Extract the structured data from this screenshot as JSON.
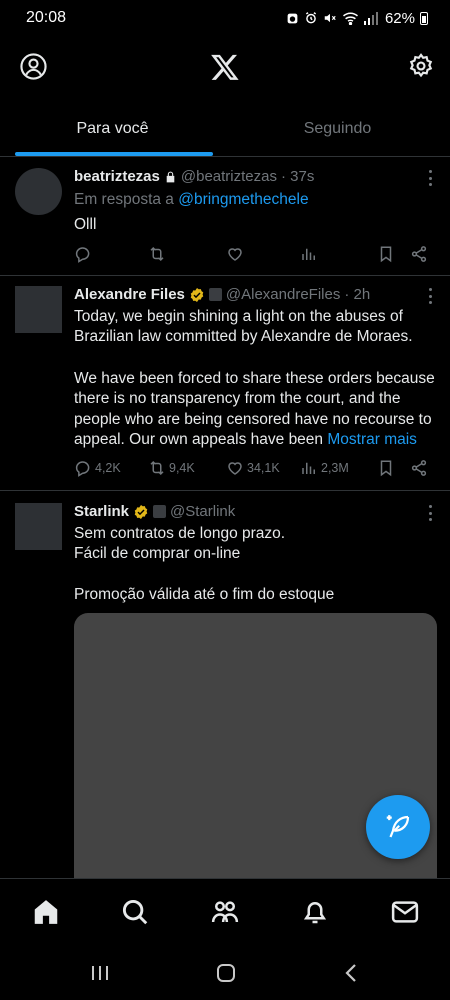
{
  "status_bar": {
    "time": "20:08",
    "battery": "62%"
  },
  "header": {
    "logo": "X"
  },
  "tabs": [
    {
      "label": "Para você",
      "active": true
    },
    {
      "label": "Seguindo",
      "active": false
    }
  ],
  "tweets": [
    {
      "name": "beatriztezas",
      "locked": true,
      "handle": "@beatriztezas",
      "time": "· 37s",
      "reply_prefix": "Em resposta a ",
      "reply_to": "@bringmethechele",
      "text": "Olll",
      "counts": {
        "reply": "",
        "retweet": "",
        "like": "",
        "views": ""
      }
    },
    {
      "name": "Alexandre Files",
      "verified": true,
      "handle": "@AlexandreFiles",
      "time": "· 2h",
      "text_1": "Today, we begin shining a light on the abuses of Brazilian law committed by Alexandre de Moraes.",
      "text_2": "We have been forced to share these orders because there is no transparency from the court, and the people who are being censored have no recourse to appeal. Our own appeals have been",
      "show_more": "Mostrar mais",
      "counts": {
        "reply": "4,2K",
        "retweet": "9,4K",
        "like": "34,1K",
        "views": "2,3M"
      }
    },
    {
      "name": "Starlink",
      "verified": true,
      "handle": "@Starlink",
      "line_1": "Sem contratos de longo prazo.",
      "line_2": "Fácil de comprar on-line",
      "line_3": "Promoção válida até o fim do estoque"
    }
  ],
  "colors": {
    "accent": "#1d9bf0",
    "verified": "#e2b719",
    "background": "#000000",
    "muted": "#71767b"
  }
}
